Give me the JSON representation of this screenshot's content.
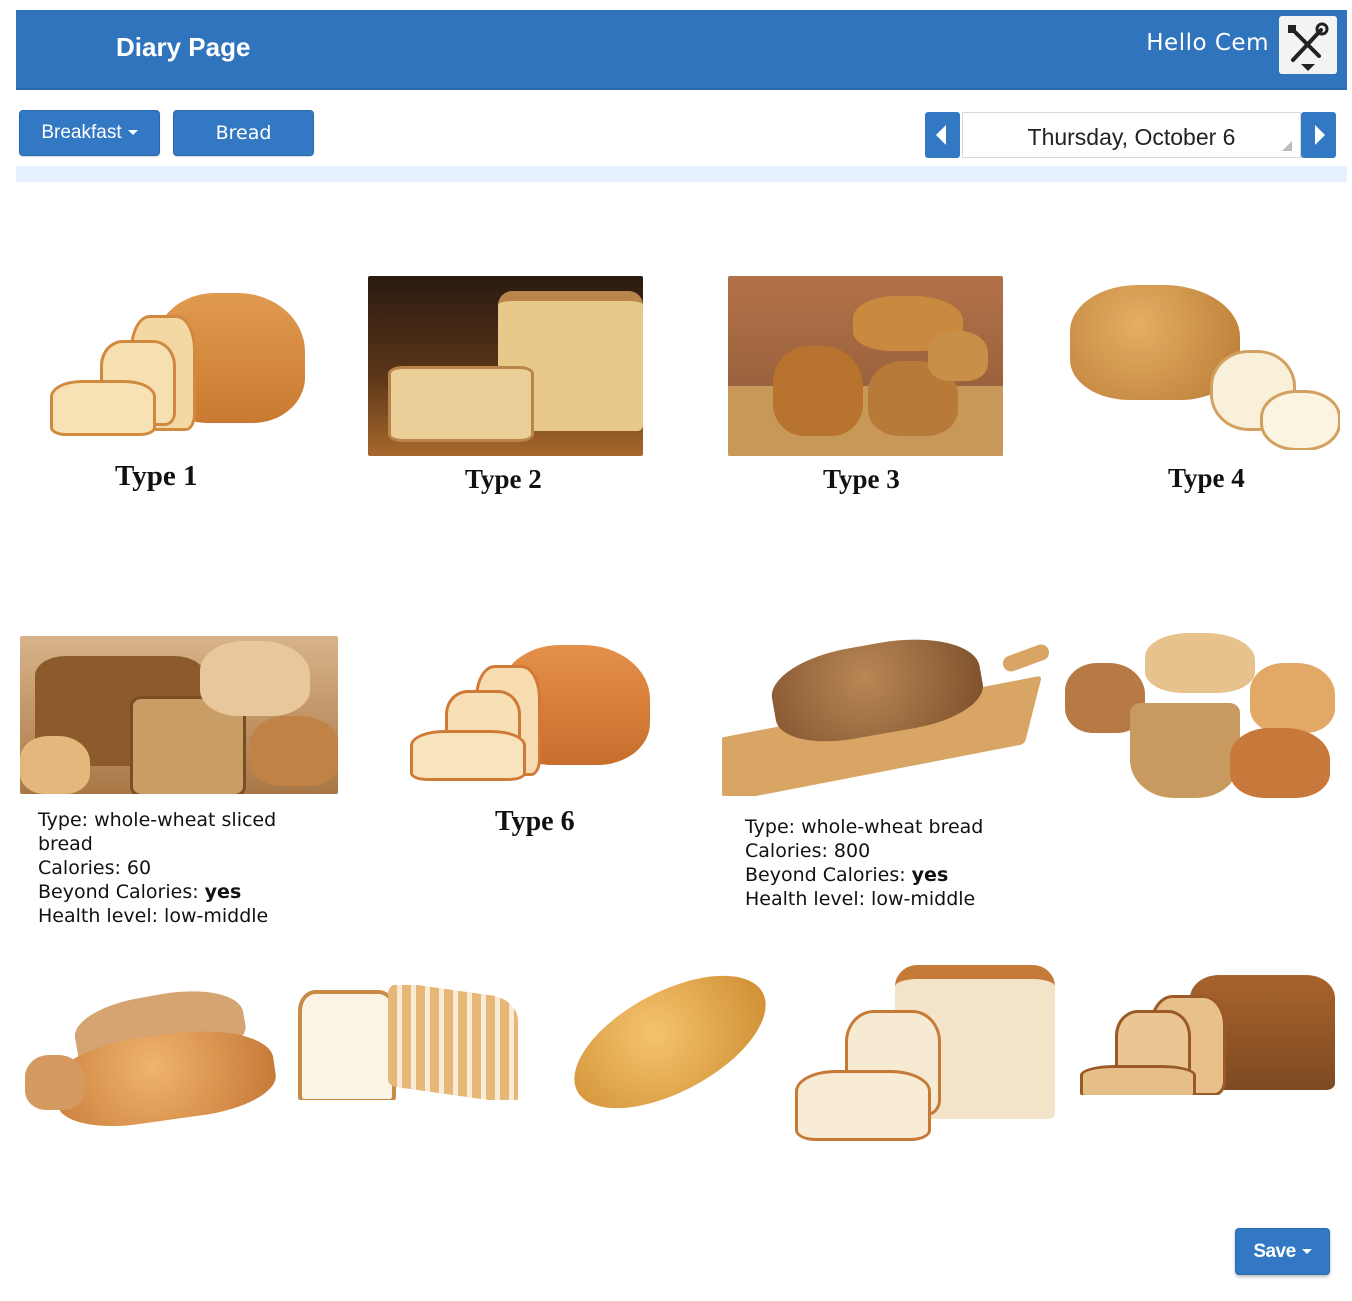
{
  "header": {
    "title": "Diary Page",
    "greeting": "Hello Cem",
    "tools_icon": "tools-icon"
  },
  "toolbar": {
    "meal_label": "Breakfast",
    "category_label": "Bread",
    "date_label": "Thursday, October 6"
  },
  "grid": {
    "row1": [
      {
        "label": "Type 1"
      },
      {
        "label": "Type 2"
      },
      {
        "label": "Type 3"
      },
      {
        "label": "Type 4"
      }
    ],
    "row2": {
      "info1": {
        "type_line": "Type: whole-wheat sliced bread",
        "calories_line": "Calories: 60",
        "beyond_prefix": "Beyond Calories: ",
        "beyond_value": "yes",
        "health_line": "Health level: low-middle"
      },
      "type6_label": "Type 6",
      "info2": {
        "type_line": "Type: whole-wheat bread",
        "calories_line": "Calories: 800",
        "beyond_prefix": "Beyond Calories: ",
        "beyond_value": "yes",
        "health_line": "Health level: low-middle"
      }
    }
  },
  "footer": {
    "save_label": "Save"
  },
  "colors": {
    "brand_blue": "#2f74bd",
    "divider": "#e4f0fb"
  }
}
